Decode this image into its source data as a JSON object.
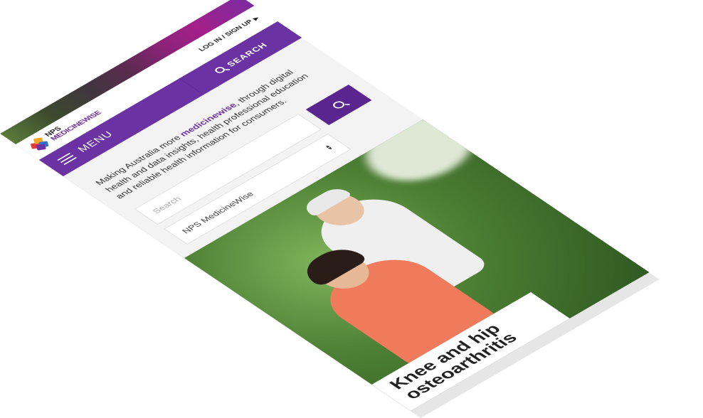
{
  "header": {
    "logo_nps": "NPS",
    "logo_medicinewise": "MEDICINEWISE",
    "login_label": "LOG IN / SIGN UP"
  },
  "nav": {
    "menu_label": "MENU",
    "search_label": "SEARCH"
  },
  "intro": {
    "text_before": "Making Australia more ",
    "brand_word": "medicinewise",
    "text_after": ", through digital health and data insights, health professional education and reliable health information for consumers."
  },
  "search": {
    "placeholder": "Search",
    "scope_selected": "NPS MedicineWise"
  },
  "hero": {
    "title": "Knee and hip osteoarthritis"
  },
  "colors": {
    "brand_purple": "#6b32a3",
    "search_button": "#5b2590"
  },
  "icons": {
    "menu": "hamburger-icon",
    "search": "search-icon",
    "dropdown": "up-down-arrows-icon"
  }
}
